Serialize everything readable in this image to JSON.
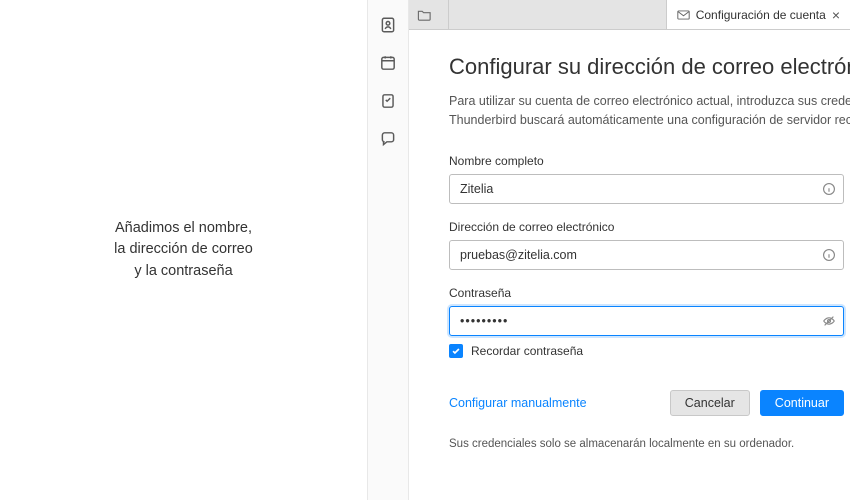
{
  "annotation": {
    "line1": "Añadimos el nombre,",
    "line2": "la dirección de correo",
    "line3": "y la contraseña"
  },
  "tab": {
    "title": "Configuración de cuenta"
  },
  "dialog": {
    "title": "Configurar su dirección de correo electrón",
    "subtitle_line1": "Para utilizar su cuenta de correo electrónico actual, introduzca sus credenciale",
    "subtitle_line2": "Thunderbird buscará automáticamente una configuración de servidor recome",
    "fields": {
      "name": {
        "label": "Nombre completo",
        "value": "Zitelia"
      },
      "email": {
        "label": "Dirección de correo electrónico",
        "value": "pruebas@zitelia.com"
      },
      "password": {
        "label": "Contraseña",
        "value": "•••••••••"
      }
    },
    "remember": {
      "label": "Recordar contraseña",
      "checked": true
    },
    "buttons": {
      "manual": "Configurar manualmente",
      "cancel": "Cancelar",
      "continue": "Continuar"
    },
    "footer": "Sus credenciales solo se almacenarán localmente en su ordenador."
  }
}
